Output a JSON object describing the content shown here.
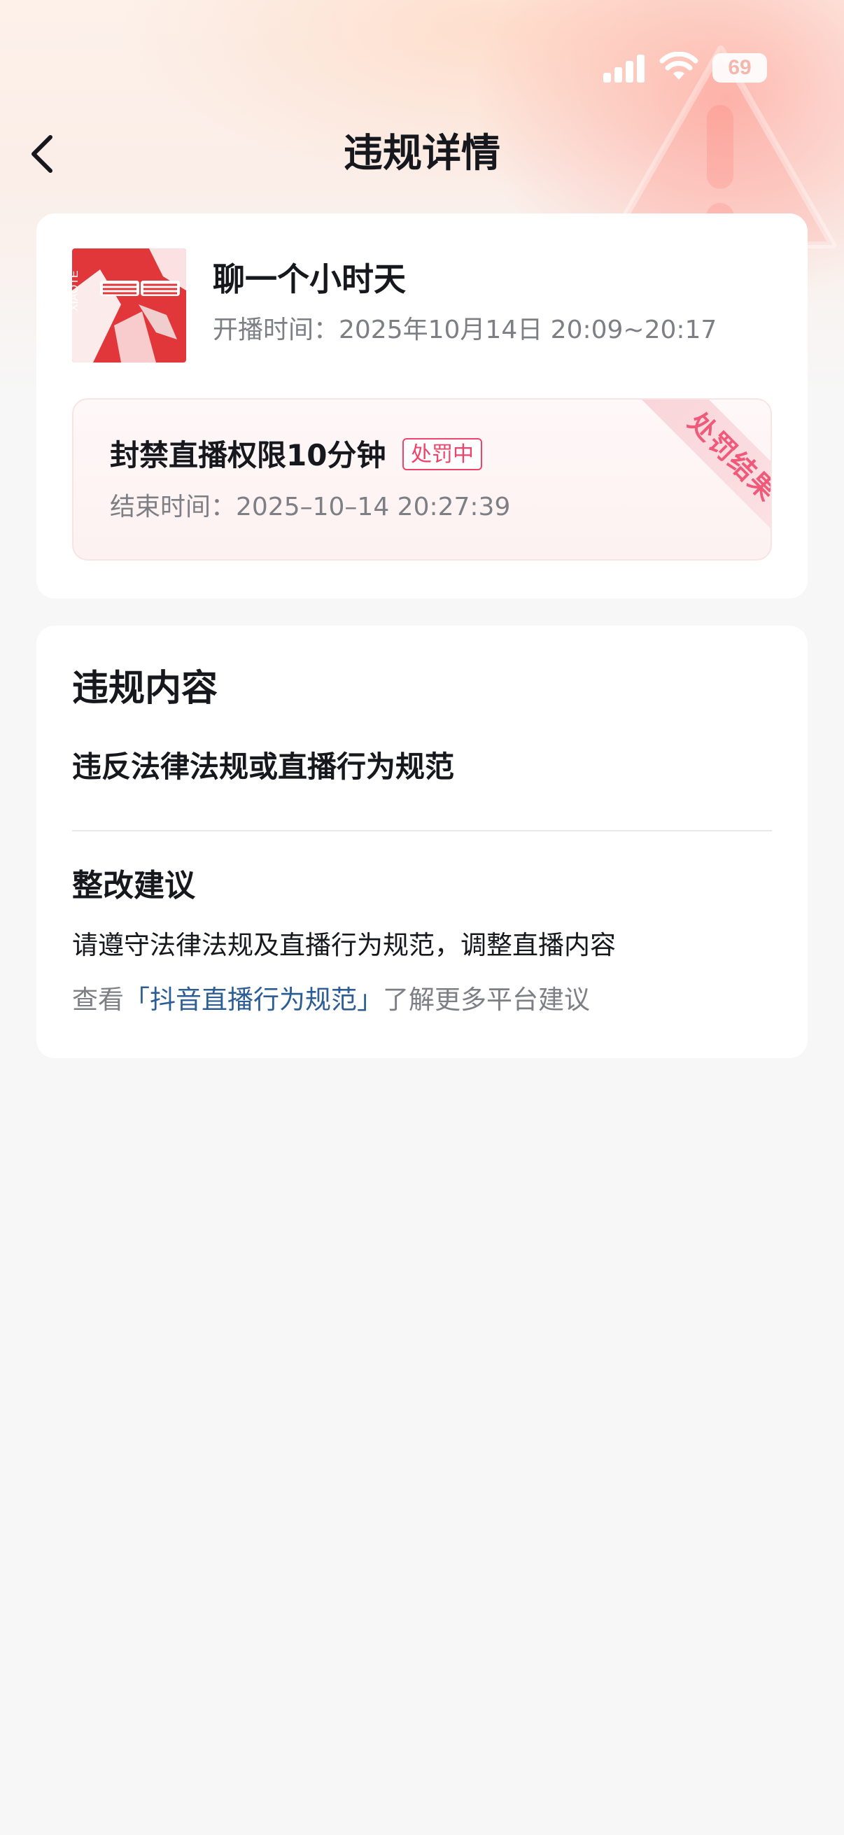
{
  "status_bar": {
    "battery_level": "69"
  },
  "nav": {
    "title": "违规详情",
    "back_icon": "chevron-left-icon"
  },
  "stream": {
    "cover_text": "XIAOTE",
    "title": "聊一个小时天",
    "time": "开播时间：2025年10月14日 20:09~20:17"
  },
  "penalty": {
    "name": "封禁直播权限10分钟",
    "status": "处罚中",
    "end_time": "结束时间：2025–10–14 20:27:39",
    "ribbon_label": "处罚结果"
  },
  "violation": {
    "section_title": "违规内容",
    "content": "违反法律法规或直播行为规范"
  },
  "advice": {
    "title": "整改建议",
    "text": "请遵守法律法规及直播行为规范，调整直播内容",
    "link_prefix": "查看",
    "link_text": "「抖音直播行为规范」",
    "link_suffix": "了解更多平台建议"
  },
  "colors": {
    "accent": "#f0436a",
    "link": "#2c5d94",
    "background": "#f7f7f7",
    "card": "#ffffff"
  }
}
